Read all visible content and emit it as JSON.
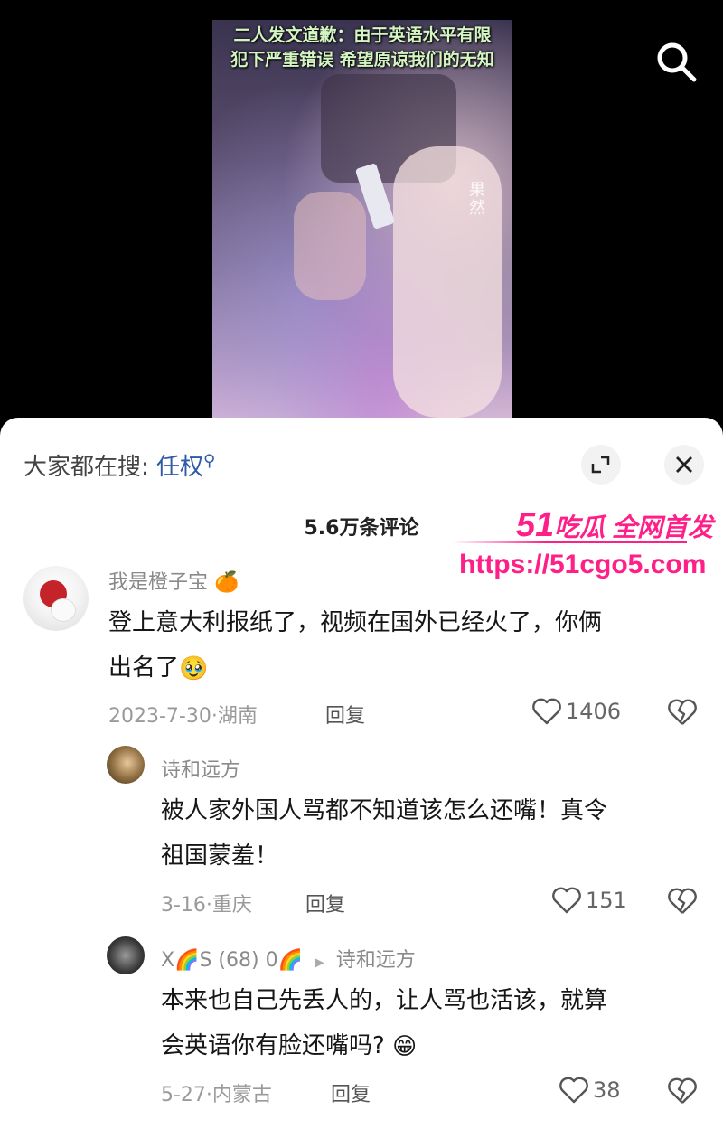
{
  "video": {
    "caption_line1": "二人发文道歉：由于英语水平有限",
    "caption_line2": "犯下严重错误 希望原谅我们的无知",
    "watermark": "果然"
  },
  "search_icon": "search-icon",
  "sheet": {
    "hot_search_label": "大家都在搜:",
    "hot_search_keyword": "任权",
    "comment_count": "5.6万条评论"
  },
  "comments": [
    {
      "username": "我是橙子宝",
      "username_emoji": "🍊",
      "text_line1": "登上意大利报纸了，视频在国外已经火了，你俩",
      "text_line2": "出名了",
      "text_emoji": "🥹",
      "date_location": "2023-7-30·湖南",
      "reply_label": "回复",
      "likes": "1406"
    },
    {
      "username": "诗和远方",
      "text_line1": "被人家外国人骂都不知道该怎么还嘴！真令",
      "text_line2": "祖国蒙羞！",
      "date_location": "3-16·重庆",
      "reply_label": "回复",
      "likes": "151"
    },
    {
      "username": "X🌈S (68) 0🌈",
      "reply_to": "诗和远方",
      "text_line1": "本来也自己先丢人的，让人骂也活该，就算",
      "text_line2": "会英语你有脸还嘴吗?",
      "text_emoji": "😁",
      "date_location": "5-27·内蒙古",
      "reply_label": "回复",
      "likes": "38"
    }
  ],
  "site_watermark": {
    "brand_number": "51",
    "brand_text": "吃瓜 全网首发",
    "url": "https://51cgo5.com"
  },
  "colors": {
    "keyword": "#2f5aa8",
    "watermark": "#ff1f88",
    "caption": "#d4f5c2"
  }
}
